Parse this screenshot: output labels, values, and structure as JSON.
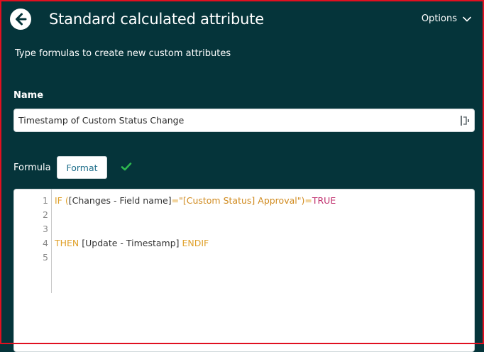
{
  "header": {
    "title": "Standard calculated attribute",
    "options_label": "Options"
  },
  "subtitle": "Type formulas to create new custom attributes",
  "name_field": {
    "label": "Name",
    "value": "Timestamp of Custom Status Change"
  },
  "formula": {
    "label": "Formula",
    "format_label": "Format",
    "valid": true,
    "line_numbers": [
      "1",
      "2",
      "3",
      "4",
      "5"
    ],
    "line1": {
      "kw_if": "IF",
      "paren_open": " (",
      "field": "[Changes - Field name]",
      "eq1": "=",
      "string": "\"[Custom Status] Approval\")",
      "eq2": "=",
      "bool": "TRUE"
    },
    "line4": {
      "kw_then": "THEN",
      "field": " [Update - Timestamp] ",
      "kw_endif": "ENDIF"
    }
  },
  "colors": {
    "background": "#05343a",
    "keyword": "#e0a12b",
    "string": "#d08a1e",
    "boolean": "#c0306e",
    "valid_check": "#2eb84f",
    "format_text": "#1f6f8b"
  },
  "icons": {
    "back": "arrow-left-circle",
    "options": "chevron-down",
    "picker": "field-picker",
    "valid": "checkmark"
  }
}
